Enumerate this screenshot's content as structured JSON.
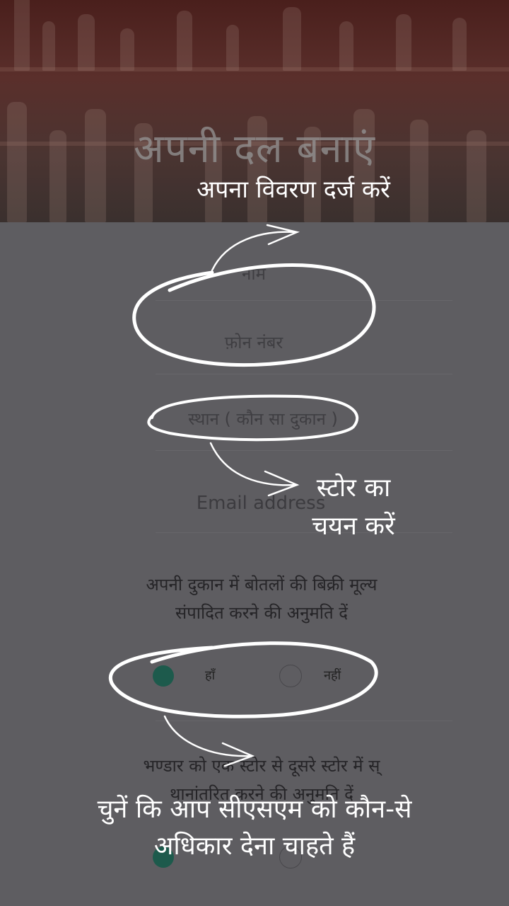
{
  "header": {
    "title": "अपनी दल बनाएं",
    "annotation": "अपना विवरण दर्ज करें"
  },
  "form": {
    "name_placeholder": "नाम",
    "phone_placeholder": "फ़ोन नंबर",
    "location_placeholder": "स्थान ( कौन सा दुकान )",
    "email_placeholder": "Email address"
  },
  "permissions": [
    {
      "text_line1": "अपनी दुकान में बोतलों की बिक्री मूल्य",
      "text_line2": "संपादित करने की अनुमति दें",
      "yes_label": "हाँ",
      "no_label": "नहीं",
      "selected": "yes"
    },
    {
      "text_line1": "भण्डार को एक स्टोर से दूसरे स्टोर में स्",
      "text_line2": "थानांतरित करने की अनुमति दें",
      "selected": "yes"
    }
  ],
  "annotations": {
    "store_line1": "स्टोर का",
    "store_line2": "चयन करें",
    "bottom_line1": "चुनें कि आप सीएसएम को कौन-से",
    "bottom_line2": "अधिकार देना चाहते हैं"
  },
  "colors": {
    "background": "#5e5d61",
    "radio_selected": "#1d5a4c",
    "annotation": "#ffffff"
  }
}
